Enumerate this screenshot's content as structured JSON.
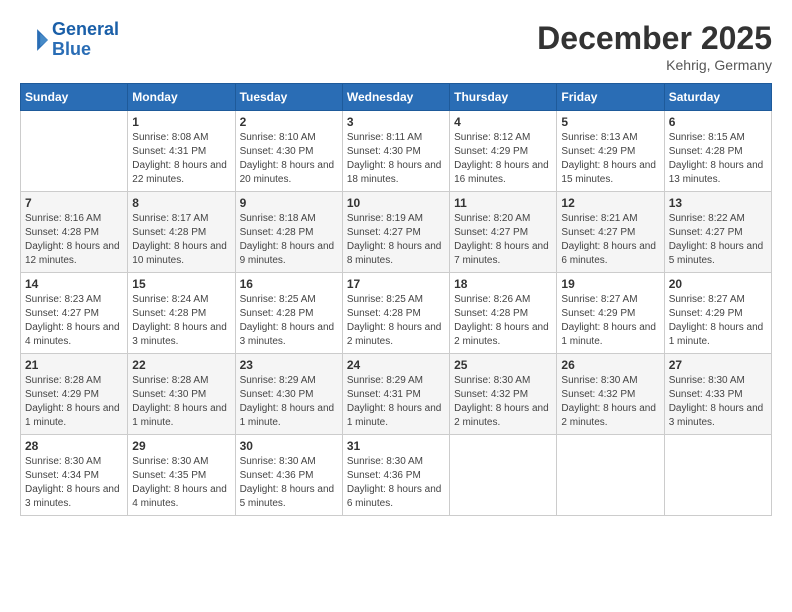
{
  "logo": {
    "line1": "General",
    "line2": "Blue"
  },
  "title": "December 2025",
  "subtitle": "Kehrig, Germany",
  "days_of_week": [
    "Sunday",
    "Monday",
    "Tuesday",
    "Wednesday",
    "Thursday",
    "Friday",
    "Saturday"
  ],
  "weeks": [
    [
      {
        "date": "",
        "sunrise": "",
        "sunset": "",
        "daylight": ""
      },
      {
        "date": "1",
        "sunrise": "Sunrise: 8:08 AM",
        "sunset": "Sunset: 4:31 PM",
        "daylight": "Daylight: 8 hours and 22 minutes."
      },
      {
        "date": "2",
        "sunrise": "Sunrise: 8:10 AM",
        "sunset": "Sunset: 4:30 PM",
        "daylight": "Daylight: 8 hours and 20 minutes."
      },
      {
        "date": "3",
        "sunrise": "Sunrise: 8:11 AM",
        "sunset": "Sunset: 4:30 PM",
        "daylight": "Daylight: 8 hours and 18 minutes."
      },
      {
        "date": "4",
        "sunrise": "Sunrise: 8:12 AM",
        "sunset": "Sunset: 4:29 PM",
        "daylight": "Daylight: 8 hours and 16 minutes."
      },
      {
        "date": "5",
        "sunrise": "Sunrise: 8:13 AM",
        "sunset": "Sunset: 4:29 PM",
        "daylight": "Daylight: 8 hours and 15 minutes."
      },
      {
        "date": "6",
        "sunrise": "Sunrise: 8:15 AM",
        "sunset": "Sunset: 4:28 PM",
        "daylight": "Daylight: 8 hours and 13 minutes."
      }
    ],
    [
      {
        "date": "7",
        "sunrise": "Sunrise: 8:16 AM",
        "sunset": "Sunset: 4:28 PM",
        "daylight": "Daylight: 8 hours and 12 minutes."
      },
      {
        "date": "8",
        "sunrise": "Sunrise: 8:17 AM",
        "sunset": "Sunset: 4:28 PM",
        "daylight": "Daylight: 8 hours and 10 minutes."
      },
      {
        "date": "9",
        "sunrise": "Sunrise: 8:18 AM",
        "sunset": "Sunset: 4:28 PM",
        "daylight": "Daylight: 8 hours and 9 minutes."
      },
      {
        "date": "10",
        "sunrise": "Sunrise: 8:19 AM",
        "sunset": "Sunset: 4:27 PM",
        "daylight": "Daylight: 8 hours and 8 minutes."
      },
      {
        "date": "11",
        "sunrise": "Sunrise: 8:20 AM",
        "sunset": "Sunset: 4:27 PM",
        "daylight": "Daylight: 8 hours and 7 minutes."
      },
      {
        "date": "12",
        "sunrise": "Sunrise: 8:21 AM",
        "sunset": "Sunset: 4:27 PM",
        "daylight": "Daylight: 8 hours and 6 minutes."
      },
      {
        "date": "13",
        "sunrise": "Sunrise: 8:22 AM",
        "sunset": "Sunset: 4:27 PM",
        "daylight": "Daylight: 8 hours and 5 minutes."
      }
    ],
    [
      {
        "date": "14",
        "sunrise": "Sunrise: 8:23 AM",
        "sunset": "Sunset: 4:27 PM",
        "daylight": "Daylight: 8 hours and 4 minutes."
      },
      {
        "date": "15",
        "sunrise": "Sunrise: 8:24 AM",
        "sunset": "Sunset: 4:28 PM",
        "daylight": "Daylight: 8 hours and 3 minutes."
      },
      {
        "date": "16",
        "sunrise": "Sunrise: 8:25 AM",
        "sunset": "Sunset: 4:28 PM",
        "daylight": "Daylight: 8 hours and 3 minutes."
      },
      {
        "date": "17",
        "sunrise": "Sunrise: 8:25 AM",
        "sunset": "Sunset: 4:28 PM",
        "daylight": "Daylight: 8 hours and 2 minutes."
      },
      {
        "date": "18",
        "sunrise": "Sunrise: 8:26 AM",
        "sunset": "Sunset: 4:28 PM",
        "daylight": "Daylight: 8 hours and 2 minutes."
      },
      {
        "date": "19",
        "sunrise": "Sunrise: 8:27 AM",
        "sunset": "Sunset: 4:29 PM",
        "daylight": "Daylight: 8 hours and 1 minute."
      },
      {
        "date": "20",
        "sunrise": "Sunrise: 8:27 AM",
        "sunset": "Sunset: 4:29 PM",
        "daylight": "Daylight: 8 hours and 1 minute."
      }
    ],
    [
      {
        "date": "21",
        "sunrise": "Sunrise: 8:28 AM",
        "sunset": "Sunset: 4:29 PM",
        "daylight": "Daylight: 8 hours and 1 minute."
      },
      {
        "date": "22",
        "sunrise": "Sunrise: 8:28 AM",
        "sunset": "Sunset: 4:30 PM",
        "daylight": "Daylight: 8 hours and 1 minute."
      },
      {
        "date": "23",
        "sunrise": "Sunrise: 8:29 AM",
        "sunset": "Sunset: 4:30 PM",
        "daylight": "Daylight: 8 hours and 1 minute."
      },
      {
        "date": "24",
        "sunrise": "Sunrise: 8:29 AM",
        "sunset": "Sunset: 4:31 PM",
        "daylight": "Daylight: 8 hours and 1 minute."
      },
      {
        "date": "25",
        "sunrise": "Sunrise: 8:30 AM",
        "sunset": "Sunset: 4:32 PM",
        "daylight": "Daylight: 8 hours and 2 minutes."
      },
      {
        "date": "26",
        "sunrise": "Sunrise: 8:30 AM",
        "sunset": "Sunset: 4:32 PM",
        "daylight": "Daylight: 8 hours and 2 minutes."
      },
      {
        "date": "27",
        "sunrise": "Sunrise: 8:30 AM",
        "sunset": "Sunset: 4:33 PM",
        "daylight": "Daylight: 8 hours and 3 minutes."
      }
    ],
    [
      {
        "date": "28",
        "sunrise": "Sunrise: 8:30 AM",
        "sunset": "Sunset: 4:34 PM",
        "daylight": "Daylight: 8 hours and 3 minutes."
      },
      {
        "date": "29",
        "sunrise": "Sunrise: 8:30 AM",
        "sunset": "Sunset: 4:35 PM",
        "daylight": "Daylight: 8 hours and 4 minutes."
      },
      {
        "date": "30",
        "sunrise": "Sunrise: 8:30 AM",
        "sunset": "Sunset: 4:36 PM",
        "daylight": "Daylight: 8 hours and 5 minutes."
      },
      {
        "date": "31",
        "sunrise": "Sunrise: 8:30 AM",
        "sunset": "Sunset: 4:36 PM",
        "daylight": "Daylight: 8 hours and 6 minutes."
      },
      {
        "date": "",
        "sunrise": "",
        "sunset": "",
        "daylight": ""
      },
      {
        "date": "",
        "sunrise": "",
        "sunset": "",
        "daylight": ""
      },
      {
        "date": "",
        "sunrise": "",
        "sunset": "",
        "daylight": ""
      }
    ]
  ]
}
